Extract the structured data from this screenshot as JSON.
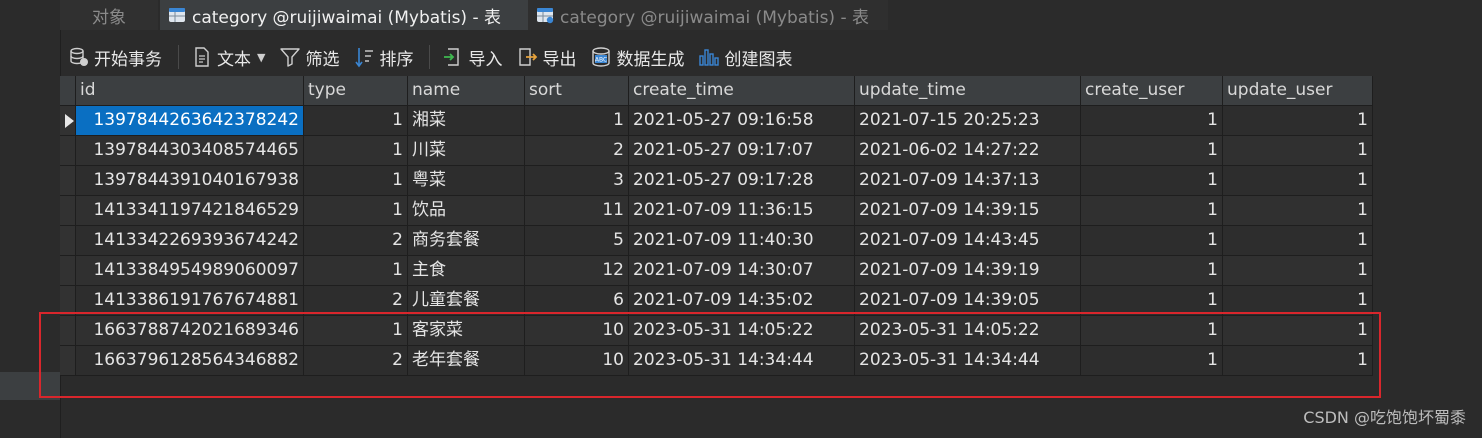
{
  "tabs": {
    "objects_label": "对象",
    "active_label": "category @ruijiwaimai (Mybatis) - 表",
    "inactive_label": "category @ruijiwaimai (Mybatis) - 表"
  },
  "toolbar": {
    "begin_transaction": "开始事务",
    "text": "文本",
    "filter": "筛选",
    "sort": "排序",
    "import": "导入",
    "export": "导出",
    "data_generation": "数据生成",
    "create_chart": "创建图表"
  },
  "table": {
    "columns": [
      "id",
      "type",
      "name",
      "sort",
      "create_time",
      "update_time",
      "create_user",
      "update_user"
    ],
    "rows": [
      [
        "1397844263642378242",
        "1",
        "湘菜",
        "1",
        "2021-05-27 09:16:58",
        "2021-07-15 20:25:23",
        "1",
        "1"
      ],
      [
        "1397844303408574465",
        "1",
        "川菜",
        "2",
        "2021-05-27 09:17:07",
        "2021-06-02 14:27:22",
        "1",
        "1"
      ],
      [
        "1397844391040167938",
        "1",
        "粤菜",
        "3",
        "2021-05-27 09:17:28",
        "2021-07-09 14:37:13",
        "1",
        "1"
      ],
      [
        "1413341197421846529",
        "1",
        "饮品",
        "11",
        "2021-07-09 11:36:15",
        "2021-07-09 14:39:15",
        "1",
        "1"
      ],
      [
        "1413342269393674242",
        "2",
        "商务套餐",
        "5",
        "2021-07-09 11:40:30",
        "2021-07-09 14:43:45",
        "1",
        "1"
      ],
      [
        "1413384954989060097",
        "1",
        "主食",
        "12",
        "2021-07-09 14:30:07",
        "2021-07-09 14:39:19",
        "1",
        "1"
      ],
      [
        "1413386191767674881",
        "2",
        "儿童套餐",
        "6",
        "2021-07-09 14:35:02",
        "2021-07-09 14:39:05",
        "1",
        "1"
      ],
      [
        "1663788742021689346",
        "1",
        "客家菜",
        "10",
        "2023-05-31 14:05:22",
        "2023-05-31 14:05:22",
        "1",
        "1"
      ],
      [
        "1663796128564346882",
        "2",
        "老年套餐",
        "10",
        "2023-05-31 14:34:44",
        "2023-05-31 14:34:44",
        "1",
        "1"
      ]
    ]
  },
  "watermark": "CSDN @吃饱饱坏蜀黍",
  "colors": {
    "selection": "#0a6fc2",
    "annotation_box": "#d9262c",
    "background": "#2b2b2b"
  }
}
